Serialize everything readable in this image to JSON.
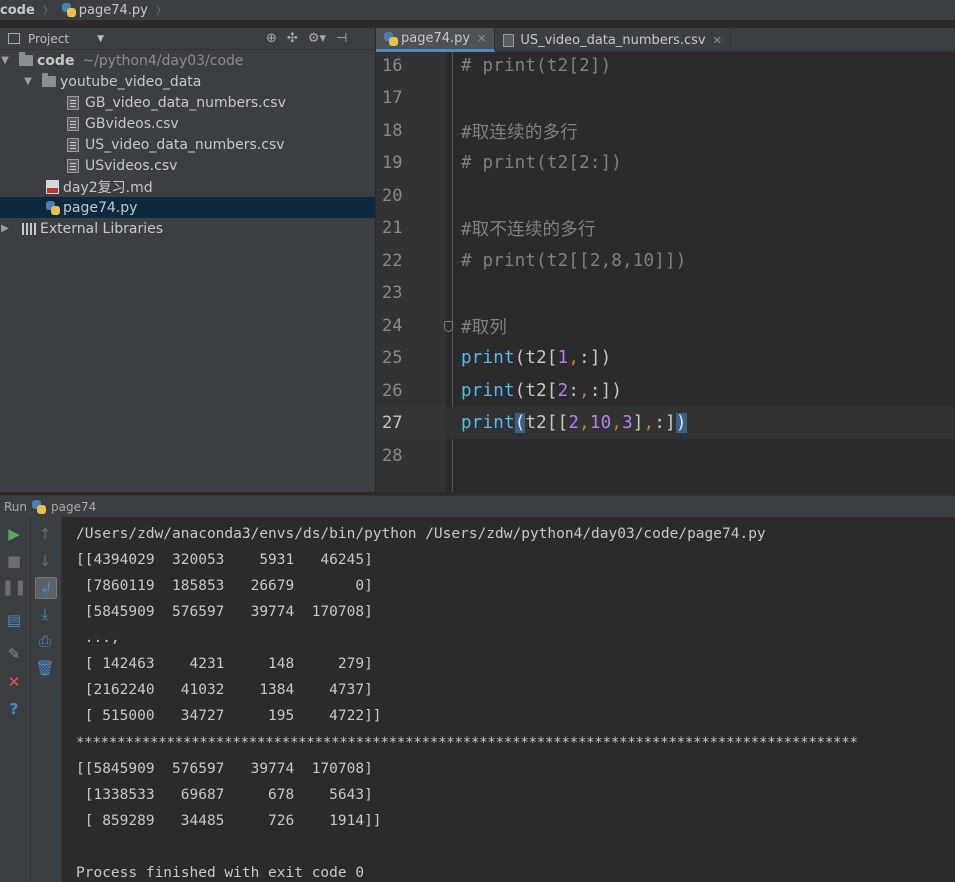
{
  "breadcrumb": {
    "root": "code",
    "file": "page74.py"
  },
  "project_panel": {
    "title": "Project",
    "tree": {
      "root": {
        "name": "code",
        "path": "~/python4/day03/code"
      },
      "folder": "youtube_video_data",
      "files_in_folder": [
        "GB_video_data_numbers.csv",
        "GBvideos.csv",
        "US_video_data_numbers.csv",
        "USvideos.csv"
      ],
      "md_file": "day2复习.md",
      "py_file": "page74.py",
      "external": "External Libraries"
    }
  },
  "tabs": [
    {
      "label": "page74.py",
      "active": true
    },
    {
      "label": "US_video_data_numbers.csv",
      "active": false
    }
  ],
  "editor": {
    "lines": [
      {
        "num": "16",
        "code": "# print(t2[2])"
      },
      {
        "num": "17",
        "code": ""
      },
      {
        "num": "18",
        "code": "#取连续的多行"
      },
      {
        "num": "19",
        "code": "# print(t2[2:])"
      },
      {
        "num": "20",
        "code": ""
      },
      {
        "num": "21",
        "code": "#取不连续的多行"
      },
      {
        "num": "22",
        "code": "# print(t2[[2,8,10]])"
      },
      {
        "num": "23",
        "code": ""
      },
      {
        "num": "24",
        "code": "#取列"
      },
      {
        "num": "25",
        "code": "print(t2[1,:])"
      },
      {
        "num": "26",
        "code": "print(t2[2:,:])"
      },
      {
        "num": "27",
        "code": "print(t2[[2,10,3],:])"
      },
      {
        "num": "28",
        "code": ""
      }
    ]
  },
  "run": {
    "label": "Run",
    "config": "page74",
    "output": [
      "/Users/zdw/anaconda3/envs/ds/bin/python /Users/zdw/python4/day03/code/page74.py",
      "[[4394029  320053    5931   46245]",
      " [7860119  185853   26679       0]",
      " [5845909  576597   39774  170708]",
      " ...,",
      " [ 142463    4231     148     279]",
      " [2162240   41032    1384    4737]",
      " [ 515000   34727     195    4722]]",
      "***********************************************************************************************",
      "[[5845909  576597   39774  170708]",
      " [1338533   69687     678    5643]",
      " [ 859289   34485     726    1914]]",
      "",
      "Process finished with exit code 0"
    ]
  },
  "icons": {
    "run": "run-icon",
    "stop": "stop-icon",
    "pause": "pause-icon",
    "up": "up-arrow-icon",
    "down": "down-arrow-icon",
    "soft-wrap": "soft-wrap-icon",
    "scroll-end": "scroll-to-end-icon",
    "print": "print-icon",
    "trash": "trash-icon",
    "pin": "pin-icon",
    "close": "close-icon",
    "help": "help-icon"
  }
}
